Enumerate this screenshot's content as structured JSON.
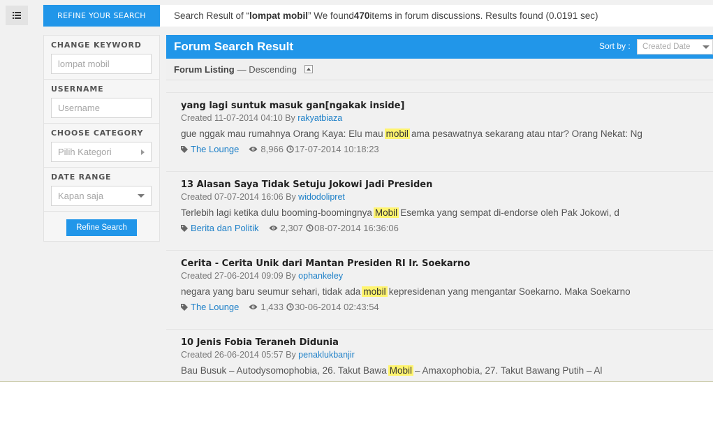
{
  "sidebar_toggle": {
    "icon": "list-icon"
  },
  "refine_tab": {
    "label": "REFINE YOUR SEARCH"
  },
  "summary": {
    "prefix": "Search Result of “",
    "keyword": "lompat mobil",
    "middle": "” We found ",
    "count": "470",
    "suffix": " items in forum discussions. Results found (0.0191 sec)"
  },
  "filters": {
    "keyword": {
      "label": "CHANGE KEYWORD",
      "value": "lompat mobil"
    },
    "username": {
      "label": "USERNAME",
      "placeholder": "Username"
    },
    "category": {
      "label": "CHOOSE CATEGORY",
      "placeholder": "Pilih Kategori"
    },
    "date_range": {
      "label": "DATE RANGE",
      "value": "Kapan saja"
    },
    "submit_label": "Refine Search"
  },
  "results_header": {
    "title": "Forum Search Result",
    "sort_label": "Sort by :",
    "sort_value": "Created Date"
  },
  "listing": {
    "label": "Forum Listing",
    "order": "— Descending"
  },
  "colors": {
    "accent": "#2196e9",
    "highlight": "#fff46e",
    "link": "#1e80c8"
  },
  "results": [
    {
      "title": "yang lagi suntuk masuk gan[ngakak inside]",
      "created": "Created 11-07-2014 04:10 By ",
      "author": "rakyatbiaza",
      "snippet_before": "gue nggak mau rumahnya Orang Kaya: Elu mau",
      "highlight": "mobil",
      "snippet_after": "ama pesawatnya sekarang atau ntar? Orang Nekat: Ng",
      "category": "The Lounge",
      "views": "8,966",
      "updated": "17-07-2014 10:18:23"
    },
    {
      "title": "13 Alasan Saya Tidak Setuju Jokowi Jadi Presiden",
      "created": "Created 07-07-2014 16:06 By ",
      "author": "widodolipret",
      "snippet_before": "Terlebih lagi ketika dulu booming-boomingnya",
      "highlight": "Mobil",
      "snippet_after": "Esemka yang sempat di-endorse oleh Pak Jokowi, d",
      "category": "Berita dan Politik",
      "views": "2,307",
      "updated": "08-07-2014 16:36:06"
    },
    {
      "title": "Cerita - Cerita Unik dari Mantan Presiden RI Ir. Soekarno",
      "created": "Created 27-06-2014 09:09 By ",
      "author": "ophankeley",
      "snippet_before": "negara yang baru seumur sehari, tidak ada",
      "highlight": "mobil",
      "snippet_after": "kepresidenan yang mengantar Soekarno. Maka Soekarno",
      "category": "The Lounge",
      "views": "1,433",
      "updated": "30-06-2014 02:43:54"
    },
    {
      "title": "10 Jenis Fobia Teraneh Didunia",
      "created": "Created 26-06-2014 05:57 By ",
      "author": "penaklukbanjir",
      "snippet_before": "Bau Busuk – Autodysomophobia, 26. Takut Bawa",
      "highlight": "Mobil",
      "snippet_after": "– Amaxophobia, 27. Takut Bawang Putih – Al",
      "category": "",
      "views": "",
      "updated": ""
    }
  ]
}
